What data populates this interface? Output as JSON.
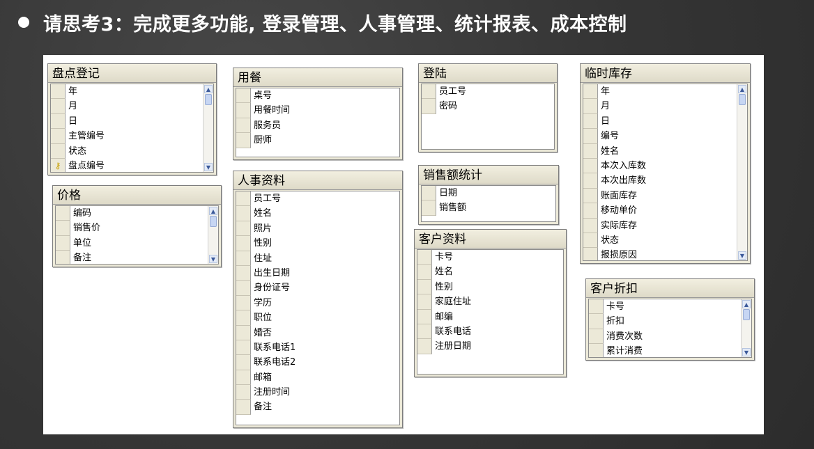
{
  "title": "请思考3：完成更多功能, 登录管理、人事管理、统计报表、成本控制",
  "tables": {
    "inventory_check": {
      "title": "盘点登记",
      "fields": [
        "年",
        "月",
        "日",
        "主管编号",
        "状态",
        "盘点编号"
      ],
      "key_field": "盘点编号"
    },
    "price": {
      "title": "价格",
      "fields": [
        "编码",
        "销售价",
        "单位",
        "备注"
      ]
    },
    "dining": {
      "title": "用餐",
      "fields": [
        "桌号",
        "用餐时间",
        "服务员",
        "厨师"
      ]
    },
    "personnel": {
      "title": "人事资料",
      "fields": [
        "员工号",
        "姓名",
        "照片",
        "性别",
        "住址",
        "出生日期",
        "身份证号",
        "学历",
        "职位",
        "婚否",
        "联系电话1",
        "联系电话2",
        "邮箱",
        "注册时间",
        "备注"
      ]
    },
    "login": {
      "title": "登陆",
      "fields": [
        "员工号",
        "密码"
      ]
    },
    "sales_stats": {
      "title": "销售额统计",
      "fields": [
        "日期",
        "销售额"
      ]
    },
    "customer": {
      "title": "客户资料",
      "fields": [
        "卡号",
        "姓名",
        "性别",
        "家庭住址",
        "邮编",
        "联系电话",
        "注册日期"
      ]
    },
    "temp_stock": {
      "title": "临时库存",
      "fields": [
        "年",
        "月",
        "日",
        "编号",
        "姓名",
        "本次入库数",
        "本次出库数",
        "账面库存",
        "移动单价",
        "实际库存",
        "状态",
        "报损原因"
      ]
    },
    "customer_discount": {
      "title": "客户折扣",
      "fields": [
        "卡号",
        "折扣",
        "消费次数",
        "累计消费"
      ]
    }
  }
}
